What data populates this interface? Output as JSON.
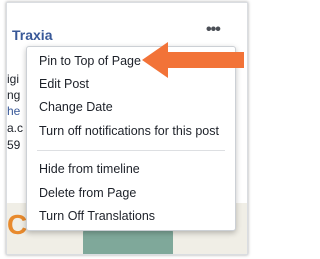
{
  "post": {
    "page_name": "Traxia",
    "snippet_lines": [
      "igi",
      "ng",
      "he",
      "a.c",
      "59"
    ],
    "more_icon": "ellipsis-icon"
  },
  "menu": {
    "items_group1": [
      "Pin to Top of Page",
      "Edit Post",
      "Change Date",
      "Turn off notifications for this post"
    ],
    "items_group2": [
      "Hide from timeline",
      "Delete from Page",
      "Turn Off Translations"
    ]
  },
  "annotation": {
    "arrow_color": "#f27338",
    "arrow_icon": "left-arrow-icon"
  }
}
